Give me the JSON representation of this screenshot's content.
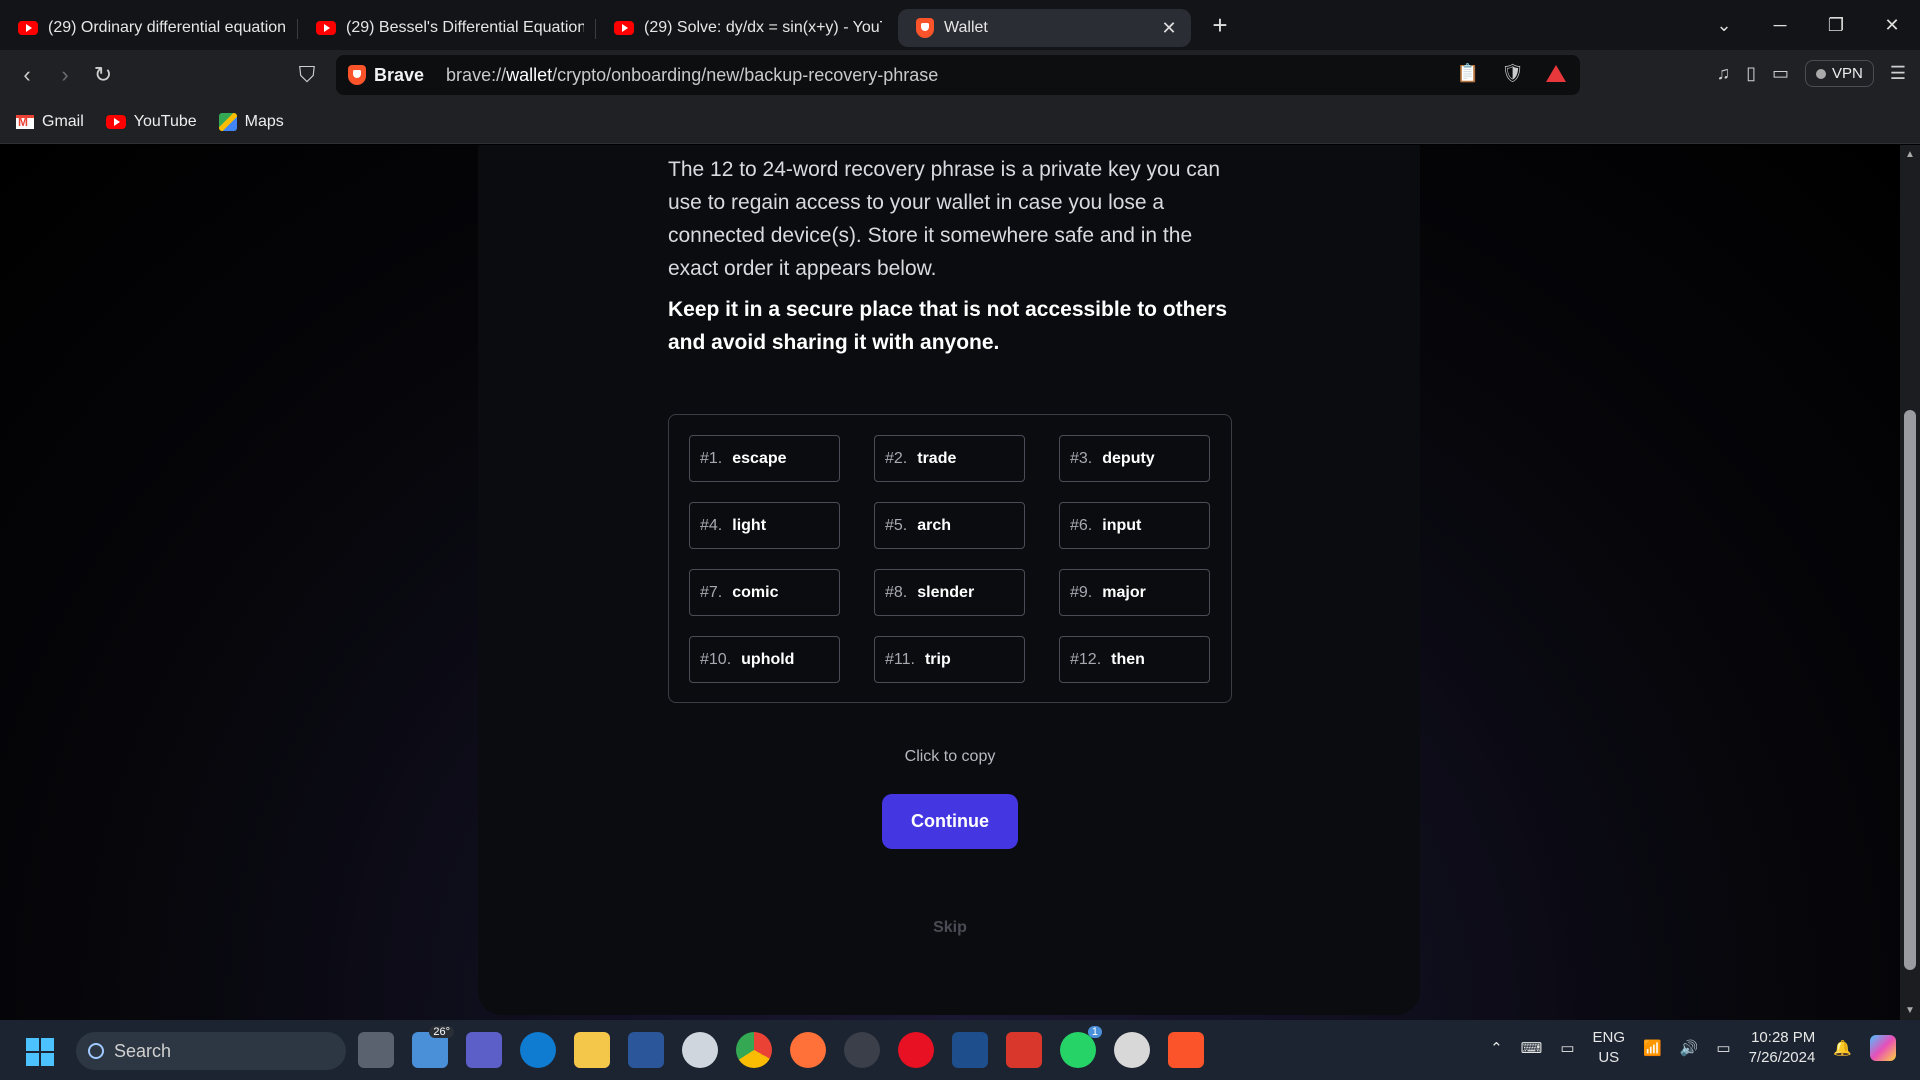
{
  "browser": {
    "tabs": [
      {
        "title": "(29) Ordinary differential equation c",
        "icon": "youtube-icon"
      },
      {
        "title": "(29) Bessel's Differential Equation - I",
        "icon": "youtube-icon"
      },
      {
        "title": "(29) Solve: dy/dx = sin(x+y) - YouTu",
        "icon": "youtube-icon"
      },
      {
        "title": "Wallet",
        "icon": "brave-icon",
        "active": true
      }
    ],
    "url_brand": "Brave",
    "url_prefix": "brave://",
    "url_host": "wallet",
    "url_path": "/crypto/onboarding/new/backup-recovery-phrase",
    "vpn_label": "VPN",
    "bookmarks": [
      {
        "label": "Gmail",
        "icon": "gmail-icon"
      },
      {
        "label": "YouTube",
        "icon": "youtube-icon"
      },
      {
        "label": "Maps",
        "icon": "maps-icon"
      }
    ]
  },
  "page": {
    "description": "The 12 to 24-word recovery phrase is a private key you can use to regain access to your wallet in case you lose a connected device(s). Store it somewhere safe and in the exact order it appears below.",
    "warning": "Keep it in a secure place that is not accessible to others and avoid sharing it with anyone.",
    "words": [
      {
        "n": "#1.",
        "w": "escape"
      },
      {
        "n": "#2.",
        "w": "trade"
      },
      {
        "n": "#3.",
        "w": "deputy"
      },
      {
        "n": "#4.",
        "w": "light"
      },
      {
        "n": "#5.",
        "w": "arch"
      },
      {
        "n": "#6.",
        "w": "input"
      },
      {
        "n": "#7.",
        "w": "comic"
      },
      {
        "n": "#8.",
        "w": "slender"
      },
      {
        "n": "#9.",
        "w": "major"
      },
      {
        "n": "#10.",
        "w": "uphold"
      },
      {
        "n": "#11.",
        "w": "trip"
      },
      {
        "n": "#12.",
        "w": "then"
      }
    ],
    "copy_hint": "Click to copy",
    "continue_label": "Continue",
    "skip_label": "Skip",
    "accent_color": "#4436e1"
  },
  "taskbar": {
    "search_placeholder": "Search",
    "weather_temp": "26°",
    "whatsapp_badge": "1",
    "lang_line1": "ENG",
    "lang_line2": "US",
    "time": "10:28 PM",
    "date": "7/26/2024"
  }
}
